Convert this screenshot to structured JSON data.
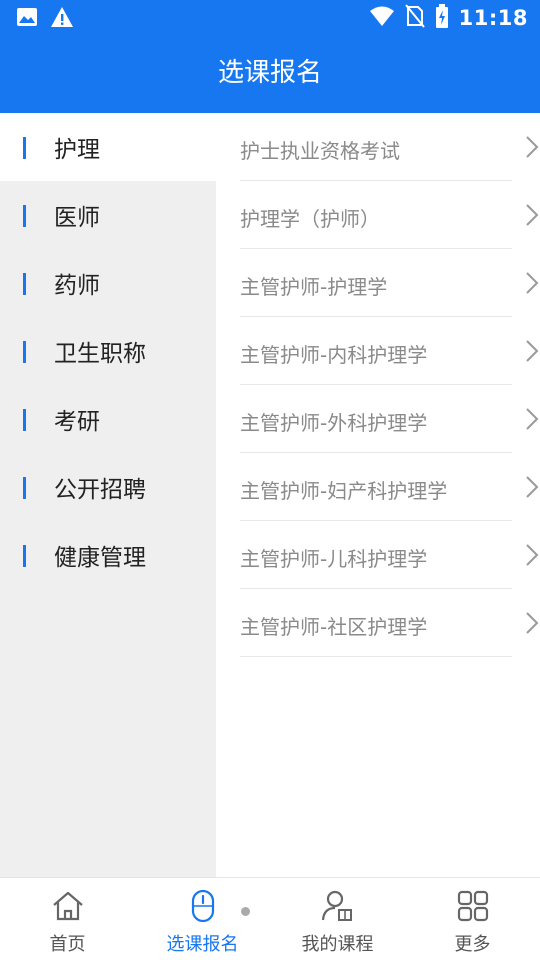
{
  "status_bar": {
    "time": "11:18",
    "icons": [
      "image-icon",
      "warning-icon",
      "wifi-icon",
      "no-sim-icon",
      "battery-charging-icon"
    ]
  },
  "header": {
    "title": "选课报名"
  },
  "categories": [
    {
      "label": "护理",
      "active": true
    },
    {
      "label": "医师",
      "active": false
    },
    {
      "label": "药师",
      "active": false
    },
    {
      "label": "卫生职称",
      "active": false
    },
    {
      "label": "考研",
      "active": false
    },
    {
      "label": "公开招聘",
      "active": false
    },
    {
      "label": "健康管理",
      "active": false
    }
  ],
  "courses": [
    "护士执业资格考试",
    "护理学（护师）",
    "主管护师-护理学",
    "主管护师-内科护理学",
    "主管护师-外科护理学",
    "主管护师-妇产科护理学",
    "主管护师-儿科护理学",
    "主管护师-社区护理学"
  ],
  "tabbar": {
    "tabs": [
      {
        "label": "首页",
        "icon": "home-icon",
        "active": false
      },
      {
        "label": "选课报名",
        "icon": "mouse-icon",
        "active": true
      },
      {
        "label": "我的课程",
        "icon": "user-book-icon",
        "active": false
      },
      {
        "label": "更多",
        "icon": "grid-icon",
        "active": false
      }
    ]
  },
  "colors": {
    "primary": "#1677f0",
    "nav_bg": "#efefef",
    "muted_text": "#8a8a8a"
  }
}
